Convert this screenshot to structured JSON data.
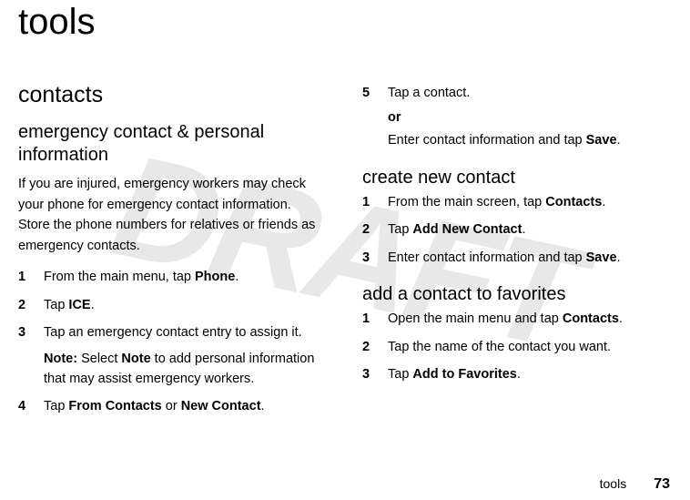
{
  "watermark": "DRAFT",
  "title": "tools",
  "left": {
    "h2": "contacts",
    "h3": "emergency contact & personal information",
    "intro": "If you are injured, emergency workers may check your phone for emergency contact information. Store the phone numbers for relatives or friends as emergency contacts.",
    "steps": [
      {
        "n": "1",
        "pre": "From the main menu, tap ",
        "bold": "Phone",
        "post": "."
      },
      {
        "n": "2",
        "pre": "Tap ",
        "bold": "ICE",
        "post": "."
      },
      {
        "n": "3",
        "pre": "Tap an emergency contact entry to assign it.",
        "bold": "",
        "post": "",
        "note_label": "Note:",
        "note_pre": " Select ",
        "note_bold": "Note",
        "note_post": " to add personal information that may assist emergency workers."
      },
      {
        "n": "4",
        "pre": "Tap ",
        "bold": "From Contacts",
        "mid": " or ",
        "bold2": "New Contact",
        "post": "."
      }
    ]
  },
  "right": {
    "top": {
      "step5_n": "5",
      "step5_text": "Tap a contact.",
      "or": "or",
      "enter_pre": "Enter contact information and tap ",
      "enter_bold": "Save",
      "enter_post": "."
    },
    "create": {
      "h3": "create new contact",
      "steps": [
        {
          "n": "1",
          "pre": "From the main screen, tap ",
          "bold": "Contacts",
          "post": "."
        },
        {
          "n": "2",
          "pre": "Tap ",
          "bold": "Add New Contact",
          "post": "."
        },
        {
          "n": "3",
          "pre": "Enter contact information and tap ",
          "bold": "Save",
          "post": "."
        }
      ]
    },
    "fav": {
      "h3": "add a contact to favorites",
      "steps": [
        {
          "n": "1",
          "pre": "Open the main menu and tap ",
          "bold": "Contacts",
          "post": "."
        },
        {
          "n": "2",
          "pre": "Tap the name of the contact you want.",
          "bold": "",
          "post": ""
        },
        {
          "n": "3",
          "pre": "Tap ",
          "bold": "Add to Favorites",
          "post": "."
        }
      ]
    }
  },
  "footer": {
    "label": "tools",
    "page": "73"
  }
}
